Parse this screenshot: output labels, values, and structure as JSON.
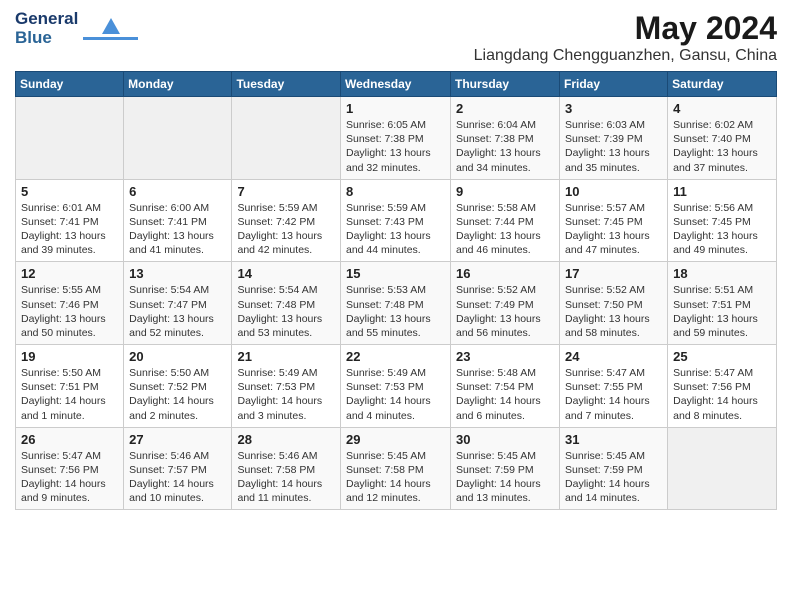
{
  "header": {
    "logo_line1": "General",
    "logo_line2": "Blue",
    "title": "May 2024",
    "subtitle": "Liangdang Chengguanzhen, Gansu, China"
  },
  "calendar": {
    "weekdays": [
      "Sunday",
      "Monday",
      "Tuesday",
      "Wednesday",
      "Thursday",
      "Friday",
      "Saturday"
    ],
    "weeks": [
      [
        {
          "day": "",
          "info": ""
        },
        {
          "day": "",
          "info": ""
        },
        {
          "day": "",
          "info": ""
        },
        {
          "day": "1",
          "info": "Sunrise: 6:05 AM\nSunset: 7:38 PM\nDaylight: 13 hours\nand 32 minutes."
        },
        {
          "day": "2",
          "info": "Sunrise: 6:04 AM\nSunset: 7:38 PM\nDaylight: 13 hours\nand 34 minutes."
        },
        {
          "day": "3",
          "info": "Sunrise: 6:03 AM\nSunset: 7:39 PM\nDaylight: 13 hours\nand 35 minutes."
        },
        {
          "day": "4",
          "info": "Sunrise: 6:02 AM\nSunset: 7:40 PM\nDaylight: 13 hours\nand 37 minutes."
        }
      ],
      [
        {
          "day": "5",
          "info": "Sunrise: 6:01 AM\nSunset: 7:41 PM\nDaylight: 13 hours\nand 39 minutes."
        },
        {
          "day": "6",
          "info": "Sunrise: 6:00 AM\nSunset: 7:41 PM\nDaylight: 13 hours\nand 41 minutes."
        },
        {
          "day": "7",
          "info": "Sunrise: 5:59 AM\nSunset: 7:42 PM\nDaylight: 13 hours\nand 42 minutes."
        },
        {
          "day": "8",
          "info": "Sunrise: 5:59 AM\nSunset: 7:43 PM\nDaylight: 13 hours\nand 44 minutes."
        },
        {
          "day": "9",
          "info": "Sunrise: 5:58 AM\nSunset: 7:44 PM\nDaylight: 13 hours\nand 46 minutes."
        },
        {
          "day": "10",
          "info": "Sunrise: 5:57 AM\nSunset: 7:45 PM\nDaylight: 13 hours\nand 47 minutes."
        },
        {
          "day": "11",
          "info": "Sunrise: 5:56 AM\nSunset: 7:45 PM\nDaylight: 13 hours\nand 49 minutes."
        }
      ],
      [
        {
          "day": "12",
          "info": "Sunrise: 5:55 AM\nSunset: 7:46 PM\nDaylight: 13 hours\nand 50 minutes."
        },
        {
          "day": "13",
          "info": "Sunrise: 5:54 AM\nSunset: 7:47 PM\nDaylight: 13 hours\nand 52 minutes."
        },
        {
          "day": "14",
          "info": "Sunrise: 5:54 AM\nSunset: 7:48 PM\nDaylight: 13 hours\nand 53 minutes."
        },
        {
          "day": "15",
          "info": "Sunrise: 5:53 AM\nSunset: 7:48 PM\nDaylight: 13 hours\nand 55 minutes."
        },
        {
          "day": "16",
          "info": "Sunrise: 5:52 AM\nSunset: 7:49 PM\nDaylight: 13 hours\nand 56 minutes."
        },
        {
          "day": "17",
          "info": "Sunrise: 5:52 AM\nSunset: 7:50 PM\nDaylight: 13 hours\nand 58 minutes."
        },
        {
          "day": "18",
          "info": "Sunrise: 5:51 AM\nSunset: 7:51 PM\nDaylight: 13 hours\nand 59 minutes."
        }
      ],
      [
        {
          "day": "19",
          "info": "Sunrise: 5:50 AM\nSunset: 7:51 PM\nDaylight: 14 hours\nand 1 minute."
        },
        {
          "day": "20",
          "info": "Sunrise: 5:50 AM\nSunset: 7:52 PM\nDaylight: 14 hours\nand 2 minutes."
        },
        {
          "day": "21",
          "info": "Sunrise: 5:49 AM\nSunset: 7:53 PM\nDaylight: 14 hours\nand 3 minutes."
        },
        {
          "day": "22",
          "info": "Sunrise: 5:49 AM\nSunset: 7:53 PM\nDaylight: 14 hours\nand 4 minutes."
        },
        {
          "day": "23",
          "info": "Sunrise: 5:48 AM\nSunset: 7:54 PM\nDaylight: 14 hours\nand 6 minutes."
        },
        {
          "day": "24",
          "info": "Sunrise: 5:47 AM\nSunset: 7:55 PM\nDaylight: 14 hours\nand 7 minutes."
        },
        {
          "day": "25",
          "info": "Sunrise: 5:47 AM\nSunset: 7:56 PM\nDaylight: 14 hours\nand 8 minutes."
        }
      ],
      [
        {
          "day": "26",
          "info": "Sunrise: 5:47 AM\nSunset: 7:56 PM\nDaylight: 14 hours\nand 9 minutes."
        },
        {
          "day": "27",
          "info": "Sunrise: 5:46 AM\nSunset: 7:57 PM\nDaylight: 14 hours\nand 10 minutes."
        },
        {
          "day": "28",
          "info": "Sunrise: 5:46 AM\nSunset: 7:58 PM\nDaylight: 14 hours\nand 11 minutes."
        },
        {
          "day": "29",
          "info": "Sunrise: 5:45 AM\nSunset: 7:58 PM\nDaylight: 14 hours\nand 12 minutes."
        },
        {
          "day": "30",
          "info": "Sunrise: 5:45 AM\nSunset: 7:59 PM\nDaylight: 14 hours\nand 13 minutes."
        },
        {
          "day": "31",
          "info": "Sunrise: 5:45 AM\nSunset: 7:59 PM\nDaylight: 14 hours\nand 14 minutes."
        },
        {
          "day": "",
          "info": ""
        }
      ]
    ]
  }
}
